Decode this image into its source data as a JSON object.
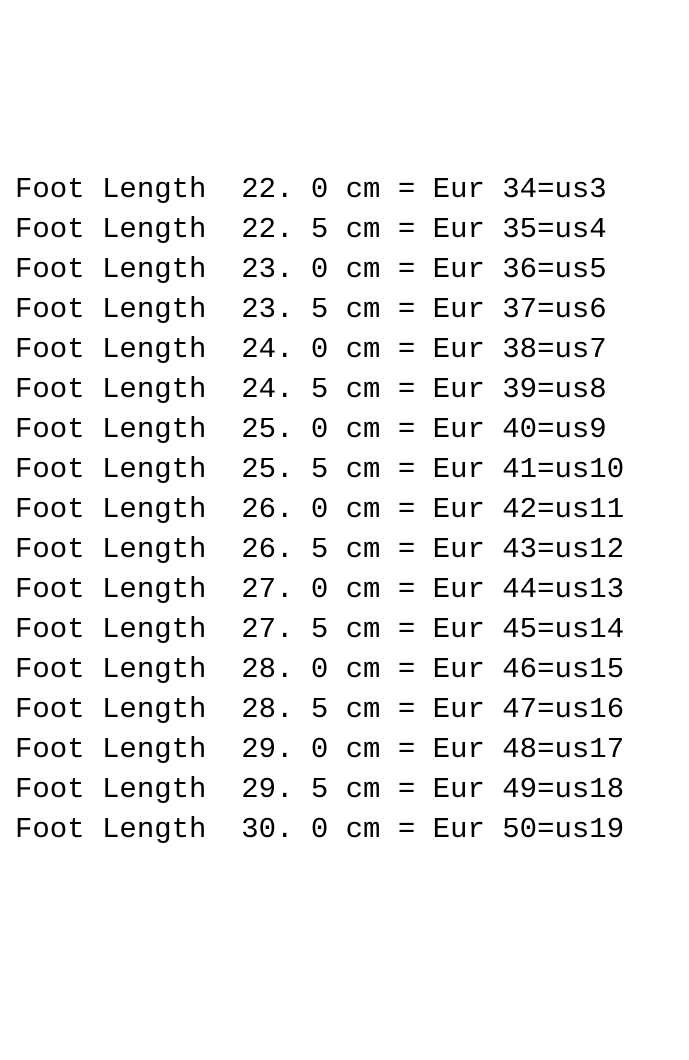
{
  "label_prefix": "Foot Length",
  "unit": "cm",
  "eur_label": "Eur",
  "us_label": "us",
  "rows": [
    {
      "foot_cm": "22.0",
      "eur": "34",
      "us": "3"
    },
    {
      "foot_cm": "22.5",
      "eur": "35",
      "us": "4"
    },
    {
      "foot_cm": "23.0",
      "eur": "36",
      "us": "5"
    },
    {
      "foot_cm": "23.5",
      "eur": "37",
      "us": "6"
    },
    {
      "foot_cm": "24.0",
      "eur": "38",
      "us": "7"
    },
    {
      "foot_cm": "24.5",
      "eur": "39",
      "us": "8"
    },
    {
      "foot_cm": "25.0",
      "eur": "40",
      "us": "9"
    },
    {
      "foot_cm": "25.5",
      "eur": "41",
      "us": "10"
    },
    {
      "foot_cm": "26.0",
      "eur": "42",
      "us": "11"
    },
    {
      "foot_cm": "26.5",
      "eur": "43",
      "us": "12"
    },
    {
      "foot_cm": "27.0",
      "eur": "44",
      "us": "13"
    },
    {
      "foot_cm": "27.5",
      "eur": "45",
      "us": "14"
    },
    {
      "foot_cm": "28.0",
      "eur": "46",
      "us": "15"
    },
    {
      "foot_cm": "28.5",
      "eur": "47",
      "us": "16"
    },
    {
      "foot_cm": "29.0",
      "eur": "48",
      "us": "17"
    },
    {
      "foot_cm": "29.5",
      "eur": "49",
      "us": "18"
    },
    {
      "foot_cm": "30.0",
      "eur": "50",
      "us": "19"
    }
  ]
}
